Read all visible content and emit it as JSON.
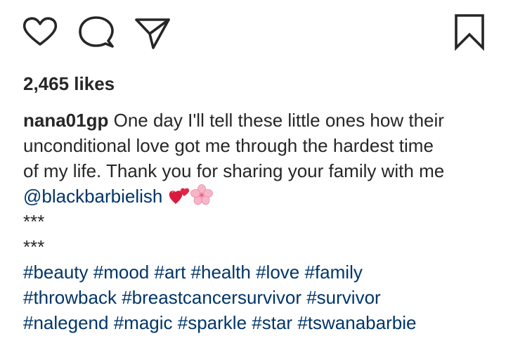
{
  "actions": {
    "like_icon": "heart-outline",
    "comment_icon": "speech-bubble",
    "share_icon": "paper-plane",
    "save_icon": "bookmark-outline"
  },
  "likes": {
    "text": "2,465 likes"
  },
  "caption": {
    "username": "nana01gp",
    "line1_text": "One day I'll tell these little ones how their",
    "line2_text": "unconditional love got me through the hardest time",
    "line3_text": "of my life. Thank you for sharing your family with me",
    "mention": "@blackbarbielish",
    "emojis": [
      "two-hearts",
      "cherry-blossom"
    ],
    "separator1": "***",
    "separator2": "***",
    "hashtag_lines": [
      [
        "#beauty",
        "#mood",
        "#art",
        "#health",
        "#love",
        "#family"
      ],
      [
        "#throwback",
        "#breastcancersurvivor",
        "#survivor"
      ],
      [
        "#nalegend",
        "#magic",
        "#sparkle",
        "#star",
        "#tswanabarbie"
      ]
    ]
  },
  "colors": {
    "text": "#262626",
    "link": "#003569",
    "background": "#ffffff"
  }
}
